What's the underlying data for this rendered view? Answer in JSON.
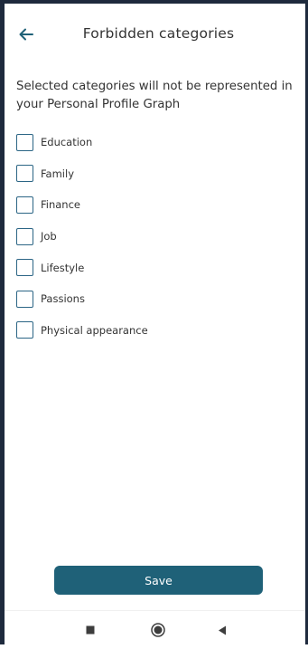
{
  "header": {
    "back_icon": "arrow-left-icon",
    "title": "Forbidden categories"
  },
  "description": "Selected categories will not be represented in your Personal Profile Graph",
  "categories": [
    {
      "label": "Education",
      "checked": false
    },
    {
      "label": "Family",
      "checked": false
    },
    {
      "label": "Finance",
      "checked": false
    },
    {
      "label": "Job",
      "checked": false
    },
    {
      "label": "Lifestyle",
      "checked": false
    },
    {
      "label": "Passions",
      "checked": false
    },
    {
      "label": "Physical appearance",
      "checked": false
    }
  ],
  "save_button": {
    "label": "Save"
  },
  "navbar": {
    "recents_icon": "square-icon",
    "home_icon": "circle-icon",
    "back_icon": "triangle-back-icon"
  },
  "colors": {
    "accent": "#1f6178",
    "checkbox_border": "#2b6585",
    "text": "#333333",
    "frame": "#1e2a3d"
  }
}
